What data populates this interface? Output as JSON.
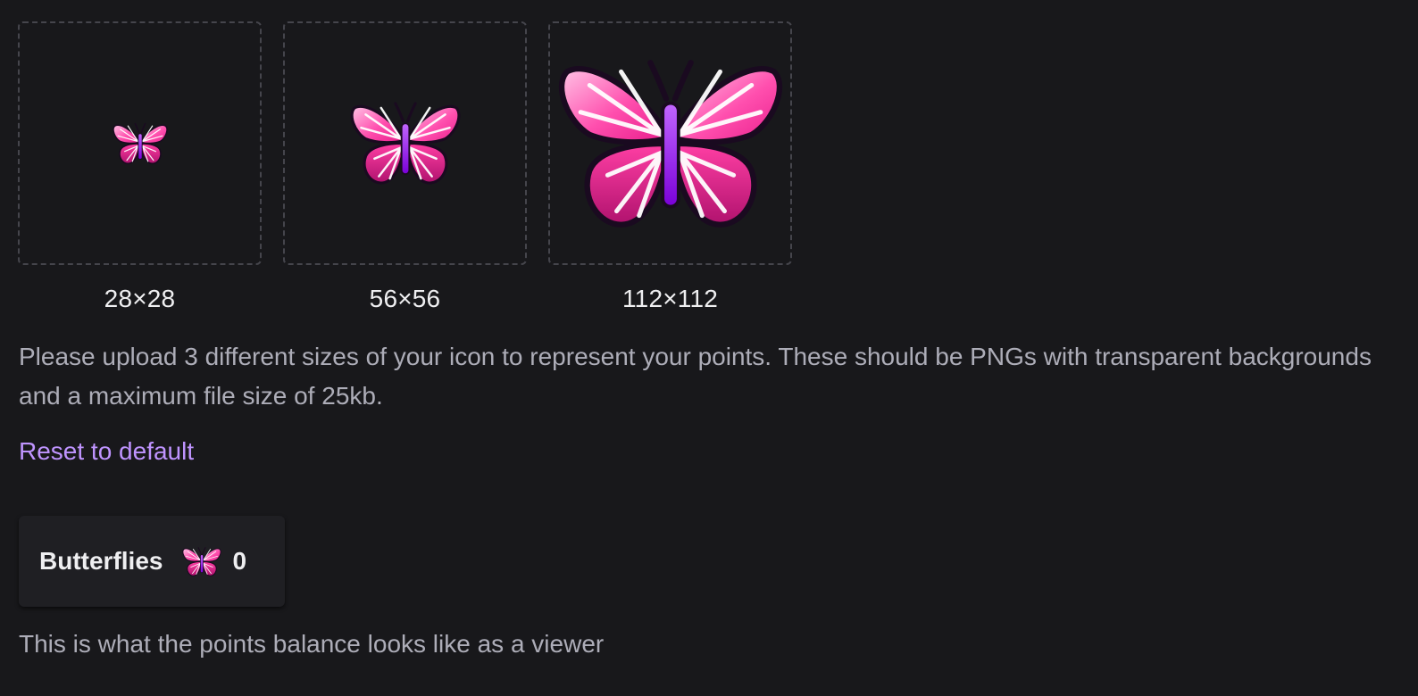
{
  "icon_uploads": [
    {
      "size_label": "28×28",
      "icon": "butterfly-icon"
    },
    {
      "size_label": "56×56",
      "icon": "butterfly-icon"
    },
    {
      "size_label": "112×112",
      "icon": "butterfly-icon"
    }
  ],
  "instructions": "Please upload 3 different sizes of your icon to represent your points. These should be PNGs with transparent backgrounds and a maximum file size of 25kb.",
  "reset_link": "Reset to default",
  "preview": {
    "points_name": "Butterflies",
    "icon": "butterfly-icon",
    "balance": "0",
    "caption": "This is what the points balance looks like as a viewer"
  },
  "colors": {
    "background": "#18181b",
    "card": "#1f1f23",
    "link": "#bf94ff",
    "muted_text": "#adadb8",
    "icon_pink": "#ff3fa4",
    "icon_purple": "#a020f0"
  }
}
